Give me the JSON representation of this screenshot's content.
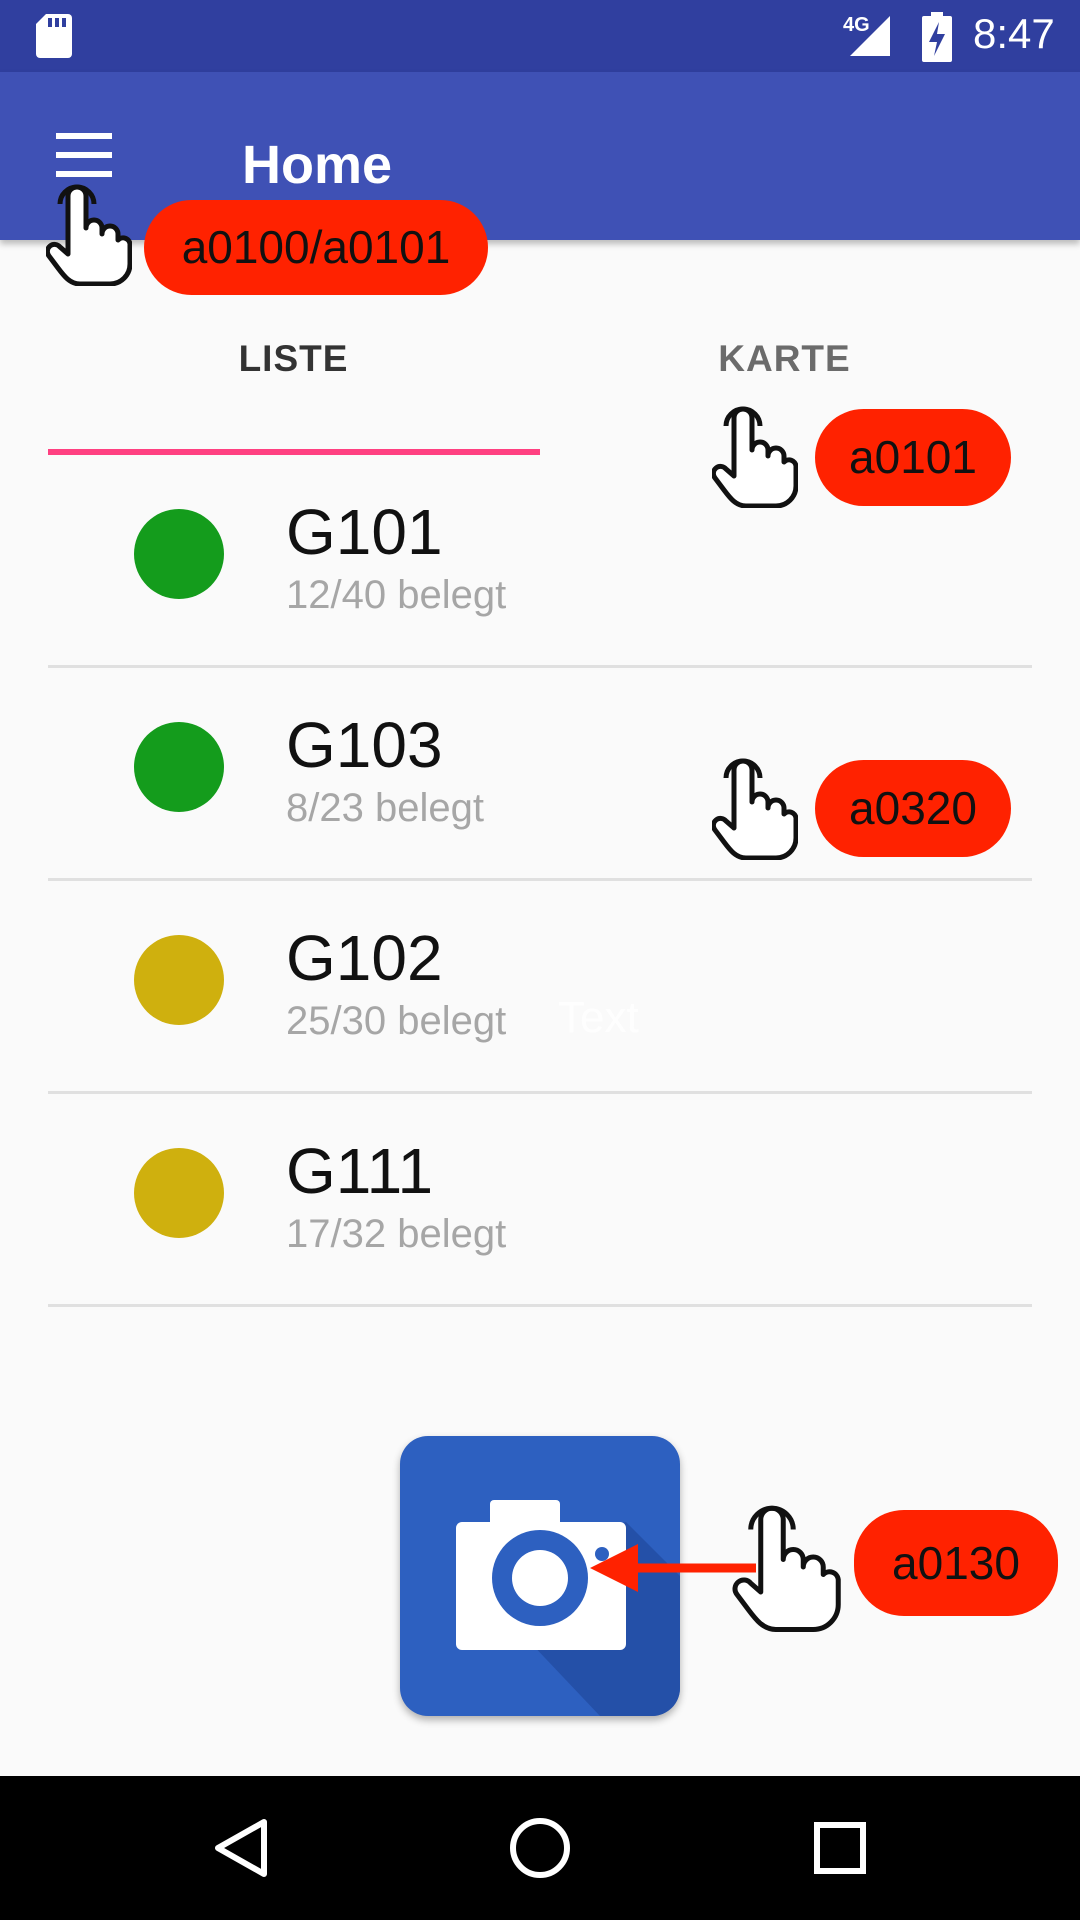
{
  "status_bar": {
    "network": "4G",
    "time": "8:47",
    "icons": [
      "sd-card-icon",
      "signal-icon",
      "battery-charging-icon"
    ],
    "background": "#303f9f"
  },
  "app_bar": {
    "title": "Home",
    "menu_icon": "hamburger-menu-icon",
    "background": "#3f51b5"
  },
  "tabs": [
    {
      "label": "LISTE",
      "selected": true
    },
    {
      "label": "KARTE",
      "selected": false
    }
  ],
  "tab_indicator_color": "#ff4081",
  "list": [
    {
      "title": "G101",
      "subtitle": "12/40 belegt",
      "status_color": "#149c1c"
    },
    {
      "title": "G103",
      "subtitle": "8/23 belegt",
      "status_color": "#149c1c"
    },
    {
      "title": "G102",
      "subtitle": "25/30 belegt",
      "status_color": "#cfb00e"
    },
    {
      "title": "G111",
      "subtitle": "17/32 belegt",
      "status_color": "#cfb00e"
    }
  ],
  "ghost_text": "Text",
  "camera_button": {
    "icon": "camera-icon",
    "color": "#2d60c0"
  },
  "annotations": [
    {
      "label": "a0100/a0101",
      "icon": "tap-hand-icon"
    },
    {
      "label": "a0101",
      "icon": "tap-hand-icon"
    },
    {
      "label": "a0320",
      "icon": "tap-hand-icon"
    },
    {
      "label": "a0130",
      "icon": "tap-hand-icon"
    }
  ],
  "annotation_color": "#ff2200",
  "nav_bar": {
    "buttons": [
      {
        "name": "back",
        "icon": "back-triangle-icon"
      },
      {
        "name": "home",
        "icon": "home-circle-icon"
      },
      {
        "name": "recents",
        "icon": "recents-square-icon"
      }
    ]
  }
}
